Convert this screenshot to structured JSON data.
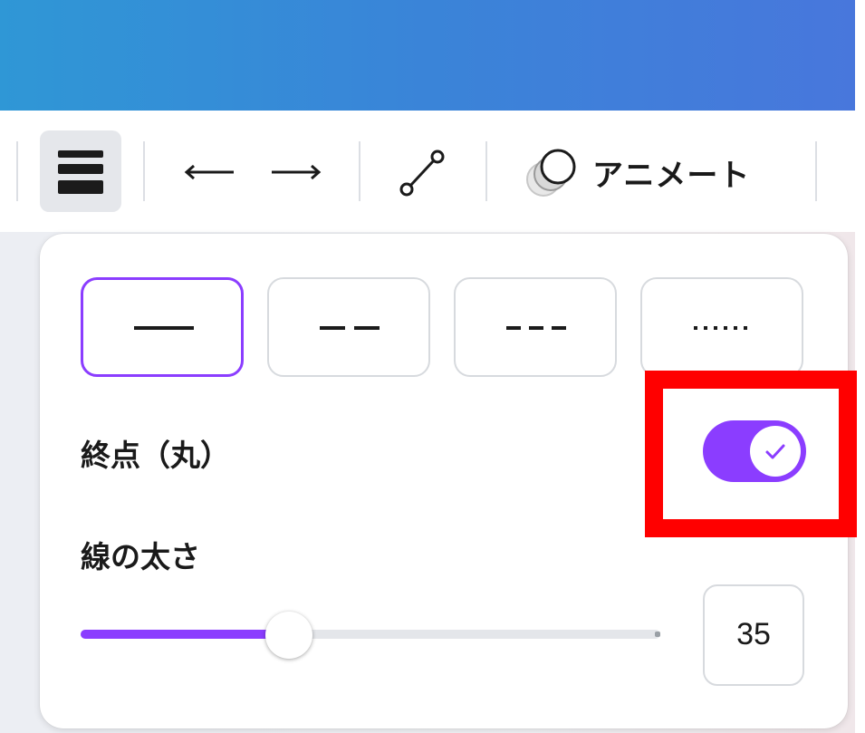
{
  "toolbar": {
    "line_weight_icon": "line-weight-icon",
    "arrow_start_icon": "arrow-left-icon",
    "arrow_end_icon": "arrow-right-icon",
    "line_type_icon": "line-connector-icon",
    "animate_icon": "animate-circles-icon",
    "animate_label": "アニメート"
  },
  "panel": {
    "line_styles": [
      {
        "id": "solid",
        "selected": true
      },
      {
        "id": "long-dash",
        "selected": false
      },
      {
        "id": "short-dash",
        "selected": false
      },
      {
        "id": "dotted",
        "selected": false
      }
    ],
    "round_end_label": "終点（丸）",
    "round_end_enabled": true,
    "thickness_label": "線の太さ",
    "thickness_value": "35",
    "thickness_fraction": 0.36
  },
  "colors": {
    "accent": "#8b3dff",
    "highlight": "#ff0000",
    "header_gradient_start": "#2f97d6",
    "header_gradient_end": "#4877dc"
  }
}
